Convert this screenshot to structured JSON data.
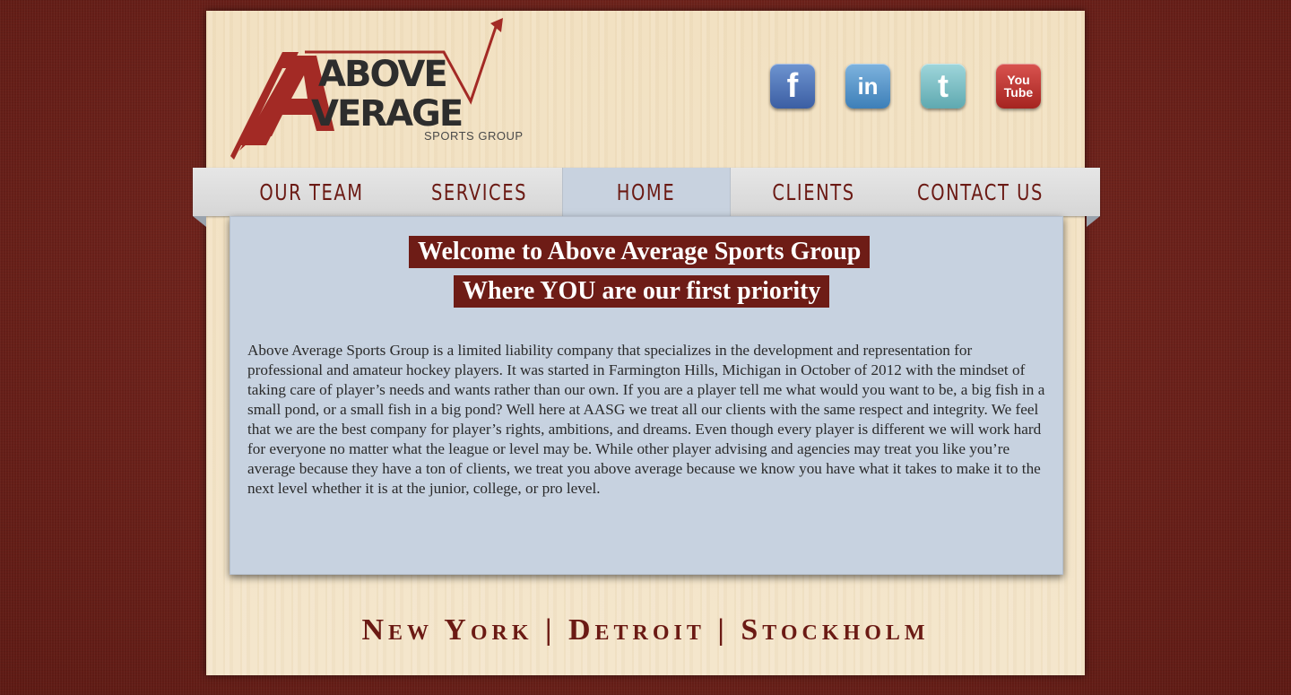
{
  "logo": {
    "line1": "ABOVE",
    "line2": "VERAGE",
    "subtitle": "SPORTS GROUP"
  },
  "social": {
    "facebook": "f",
    "linkedin": "in",
    "twitter": "t",
    "youtube_top": "You",
    "youtube_bottom": "Tube"
  },
  "nav": {
    "items": [
      {
        "label": "OUR TEAM"
      },
      {
        "label": "SERVICES"
      },
      {
        "label": "HOME"
      },
      {
        "label": "CLIENTS"
      },
      {
        "label": "CONTACT US"
      }
    ],
    "active": "HOME"
  },
  "content": {
    "title": "Welcome to Above Average Sports Group",
    "subtitle": "Where YOU are our first priority",
    "body": "Above Average Sports Group is a limited liability company that specializes in the development and representation for professional and amateur hockey players. It was started in Farmington Hills, Michigan in October of 2012 with the mindset of taking care of player’s needs and wants rather than our own. If you are a player tell me what would you want to be, a big fish in a small pond, or a small fish in a big pond? Well here at AASG we treat all our clients with the same respect and integrity. We feel that we are the best company for player’s rights, ambitions, and dreams. Even though every player is different we will work hard for everyone no matter what the league or level may be. While other player advising and agencies may treat you like you’re average because they have a ton of clients, we treat you above average because we know you have what it takes to make it to the next level whether it is at the junior, college, or pro level."
  },
  "footer": {
    "locations": "New York | Detroit | Stockholm"
  },
  "colors": {
    "brand_red": "#6e1c16",
    "background": "#6e2018",
    "content_bg": "#c7d2e0",
    "paper": "#f3e3c6"
  }
}
